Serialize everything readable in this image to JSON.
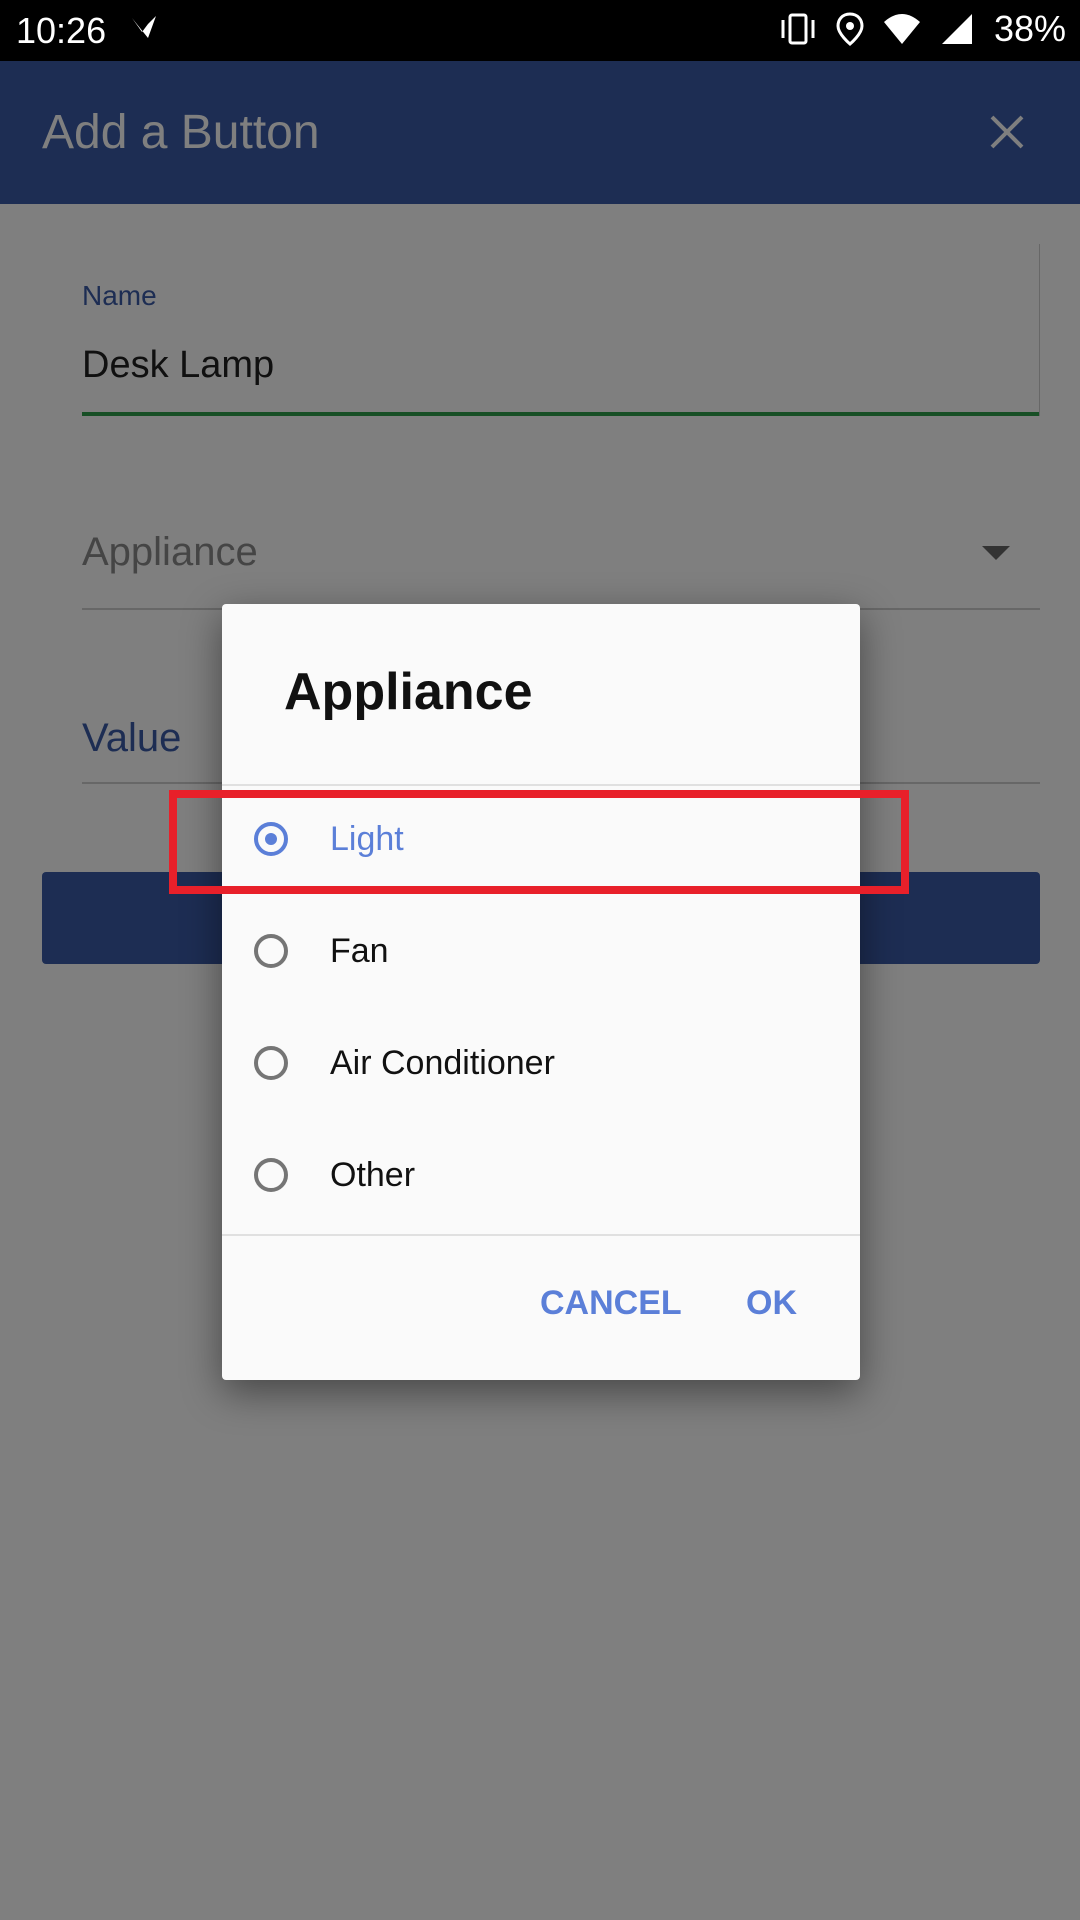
{
  "status_bar": {
    "time": "10:26",
    "battery": "38%",
    "icons": [
      "notification-icon",
      "vibrate-icon",
      "location-icon",
      "wifi-icon",
      "signal-icon"
    ]
  },
  "app_bar": {
    "title": "Add a Button",
    "close_icon": "close-icon"
  },
  "form": {
    "name_label": "Name",
    "name_value": "Desk Lamp",
    "appliance_label": "Appliance",
    "value_label": "Value"
  },
  "dialog": {
    "title": "Appliance",
    "options": [
      {
        "label": "Light",
        "selected": true
      },
      {
        "label": "Fan",
        "selected": false
      },
      {
        "label": "Air Conditioner",
        "selected": false
      },
      {
        "label": "Other",
        "selected": false
      }
    ],
    "cancel_label": "CANCEL",
    "ok_label": "OK"
  },
  "colors": {
    "app_bar": "#3b5ba7",
    "accent": "#5b7fd8",
    "highlight": "#e8202a",
    "focus_line": "#2e9e4b"
  }
}
